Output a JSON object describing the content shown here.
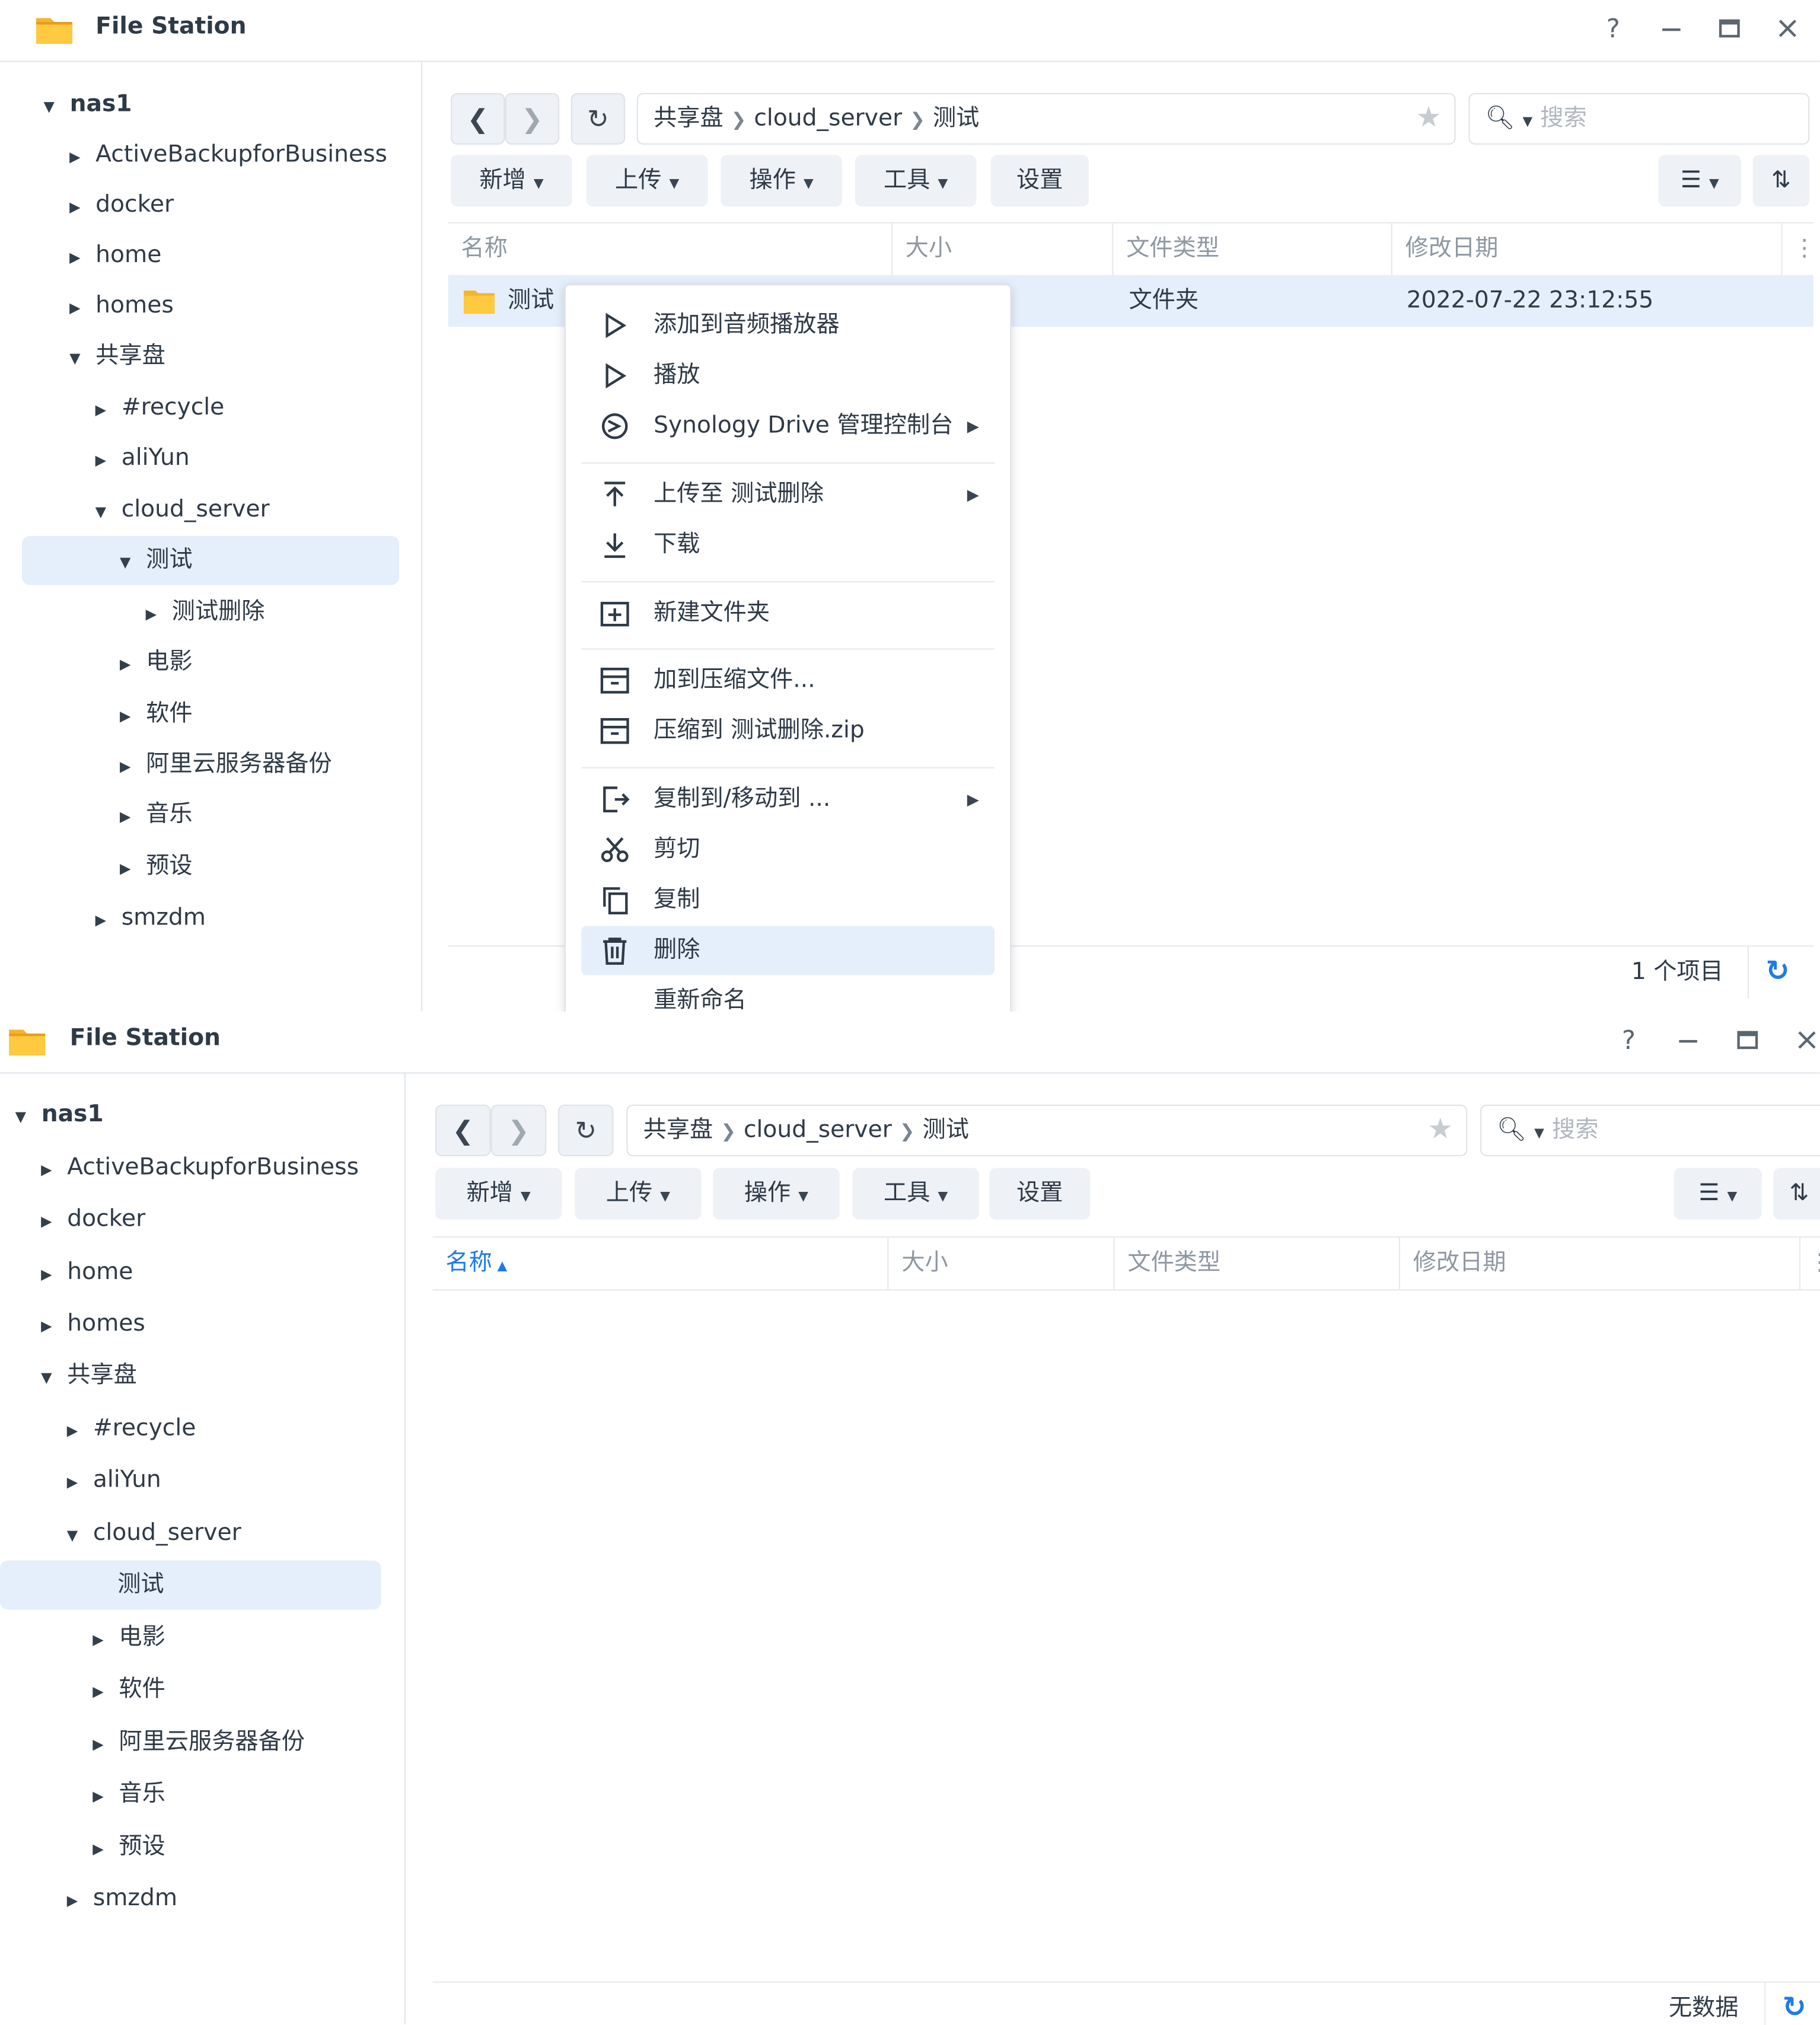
{
  "app": {
    "title": "File Station",
    "help": "?"
  },
  "tree": {
    "root": "nas1",
    "items": [
      "ActiveBackupforBusiness",
      "docker",
      "home",
      "homes"
    ],
    "share": "共享盘",
    "share_items": [
      "#recycle",
      "aliYun"
    ],
    "cloud": "cloud_server",
    "current": "测试",
    "child": "测试删除",
    "siblings": [
      "电影",
      "软件",
      "阿里云服务器备份",
      "音乐",
      "预设"
    ],
    "last": "smzdm"
  },
  "path": [
    "共享盘",
    "cloud_server",
    "测试"
  ],
  "search": {
    "placeholder": "搜索"
  },
  "toolbar": {
    "new": "新增",
    "upload": "上传",
    "action": "操作",
    "tools": "工具",
    "settings": "设置"
  },
  "columns": {
    "name": "名称",
    "size": "大小",
    "type": "文件类型",
    "modified": "修改日期"
  },
  "file_row": {
    "name": "测试删除",
    "name_visible": "测试",
    "type": "文件夹",
    "modified": "2022-07-22 23:12:55"
  },
  "footer": {
    "top_count": "1 个项目",
    "bottom_empty": "无数据"
  },
  "context_menu": {
    "add_audio": "添加到音频播放器",
    "play": "播放",
    "drive": "Synology Drive 管理控制台",
    "upload_to": "上传至 测试删除",
    "download": "下载",
    "new_folder": "新建文件夹",
    "add_archive": "加到压缩文件...",
    "compress_to": "压缩到 测试删除.zip",
    "copy_move": "复制到/移动到 ...",
    "cut": "剪切",
    "copy": "复制",
    "delete": "删除",
    "rename": "重新命名"
  },
  "colors": {
    "accent": "#1e7be5",
    "selection": "#e4effb",
    "folder": "#f6b42c"
  }
}
